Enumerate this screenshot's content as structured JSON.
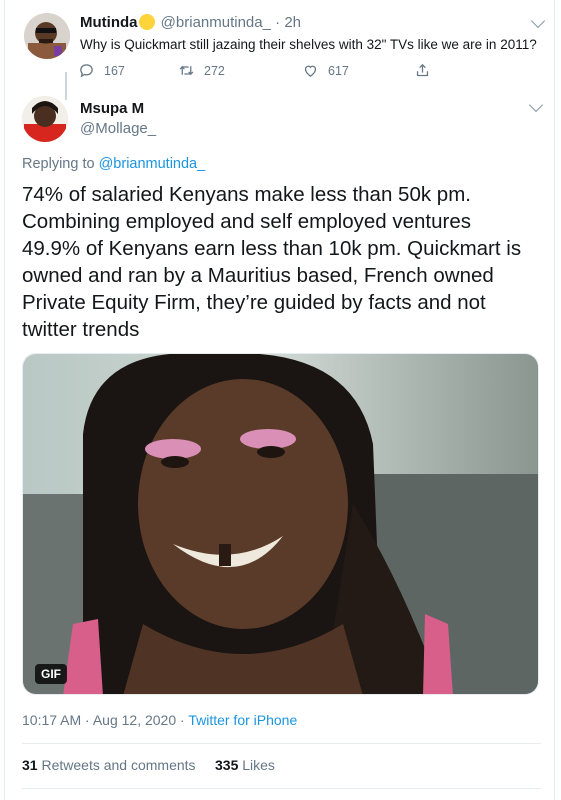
{
  "parent_tweet": {
    "name": "Mutinda",
    "handle": "@brianmutinda_",
    "separator": "·",
    "time": "2h",
    "text": "Why is Quickmart still jazaing their shelves with 32\" TVs like we are in 2011?",
    "replies": "167",
    "retweets": "272",
    "likes": "617"
  },
  "tweet": {
    "name": "Msupa M",
    "handle": "@Mollage_",
    "replying_prefix": "Replying to ",
    "replying_to": "@brianmutinda_",
    "text_lines": [
      "74% of salaried Kenyans make less than 50k pm.",
      "Combining employed and self employed ventures",
      "49.9% of Kenyans earn less than 10k pm.  Quickmart is",
      "owned and ran by a Mauritius based, French owned",
      "Private Equity Firm, they’re guided by facts and not",
      "twitter trends"
    ],
    "media_badge": "GIF",
    "timestamp": "10:17 AM · Aug 12, 2020 · ",
    "source": "Twitter for iPhone",
    "retweets_count": "31",
    "retweets_label": "Retweets and comments",
    "likes_count": "335",
    "likes_label": "Likes"
  },
  "icons": [
    "reply-icon",
    "retweet-icon",
    "like-icon",
    "share-icon",
    "more-chevron-icon",
    "verified-badge-icon"
  ],
  "colors": {
    "link": "#1b95e0",
    "secondary_text": "#657786",
    "primary_text": "#14171a",
    "verified_badge": "#ffd43b",
    "border": "#e6ecf0"
  }
}
